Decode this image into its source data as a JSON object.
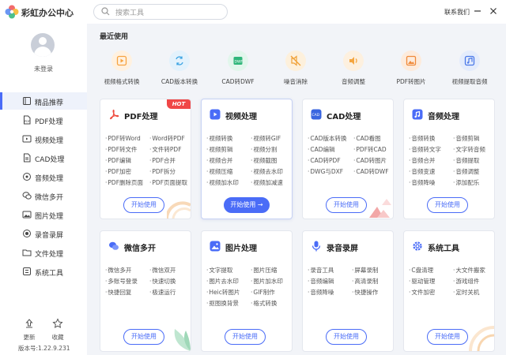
{
  "app": {
    "title": "彩虹办公中心",
    "contact": "联系我们"
  },
  "search": {
    "placeholder": "搜索工具"
  },
  "user": {
    "login_label": "未登录"
  },
  "nav": [
    {
      "label": "精品推荐",
      "icon": "recommend-icon",
      "active": true
    },
    {
      "label": "PDF处理",
      "icon": "pdf-icon"
    },
    {
      "label": "视频处理",
      "icon": "video-icon"
    },
    {
      "label": "CAD处理",
      "icon": "cad-icon"
    },
    {
      "label": "音频处理",
      "icon": "audio-icon"
    },
    {
      "label": "微信多开",
      "icon": "wechat-icon"
    },
    {
      "label": "图片处理",
      "icon": "image-icon"
    },
    {
      "label": "录音录屏",
      "icon": "record-icon"
    },
    {
      "label": "文件处理",
      "icon": "folder-icon"
    },
    {
      "label": "系统工具",
      "icon": "system-icon"
    }
  ],
  "bottom": {
    "update": "更新",
    "favorite": "收藏",
    "version": "版本号:1.22.9.231"
  },
  "recent": {
    "title": "最近使用",
    "items": [
      {
        "label": "视频格式转换",
        "color": "#f7a341",
        "bg": "#fff1e0"
      },
      {
        "label": "CAD版本转换",
        "color": "#3aa3e3",
        "bg": "#e3f2fc"
      },
      {
        "label": "CAD转DWF",
        "color": "#2fb67a",
        "bg": "#e2f6ec"
      },
      {
        "label": "噪音消除",
        "color": "#f0a035",
        "bg": "#fdf0dc"
      },
      {
        "label": "音频调整",
        "color": "#f4a640",
        "bg": "#fdf0df"
      },
      {
        "label": "PDF转图片",
        "color": "#f08a3a",
        "bg": "#fdebdc"
      },
      {
        "label": "视频提取音频",
        "color": "#4a78e8",
        "bg": "#e4ecfc"
      }
    ]
  },
  "cards": [
    {
      "title": "PDF处理",
      "badge": "HOT",
      "color": "#ee4b3e",
      "features": [
        "PDF转Word",
        "Word转PDF",
        "PDF转文件",
        "文件转PDF",
        "PDF编辑",
        "PDF合并",
        "PDF加密",
        "PDF拆分",
        "PDF删除页面",
        "PDF页面提取"
      ],
      "button": "开始使用"
    },
    {
      "title": "视频处理",
      "color": "#4a6cf7",
      "features": [
        "视频转换",
        "视频转GIF",
        "视频剪辑",
        "视频分割",
        "视频合并",
        "视频截图",
        "视频压缩",
        "视频去水印",
        "视频加水印",
        "视频加减速"
      ],
      "button": "开始使用 →"
    },
    {
      "title": "CAD处理",
      "color": "#3a66e0",
      "features": [
        "CAD版本转换",
        "CAD看图",
        "CAD编辑",
        "PDF转CAD",
        "CAD转PDF",
        "CAD转图片",
        "DWG与DXF",
        "CAD转DWF"
      ],
      "button": "开始使用"
    },
    {
      "title": "音频处理",
      "color": "#4a6cf7",
      "features": [
        "音频转换",
        "音频剪辑",
        "音频转文字",
        "文字转音频",
        "音频合并",
        "音频提取",
        "音频变速",
        "音频调整",
        "音频降噪",
        "添加配乐"
      ],
      "button": "开始使用"
    },
    {
      "title": "微信多开",
      "color": "#4a6cf7",
      "features": [
        "微信多开",
        "微信双开",
        "多账号登录",
        "快速切换",
        "快捷回复",
        "极速运行"
      ],
      "button": "开始使用"
    },
    {
      "title": "图片处理",
      "color": "#4a6cf7",
      "features": [
        "文字提取",
        "图片压缩",
        "图片去水印",
        "图片加水印",
        "Heic转图片",
        "GIF制作",
        "抠图换背景",
        "格式转换"
      ],
      "button": "开始使用"
    },
    {
      "title": "录音录屏",
      "color": "#4a6cf7",
      "features": [
        "录音工具",
        "屏幕录制",
        "音频编辑",
        "高清录制",
        "音频降噪",
        "快捷操作"
      ],
      "button": "开始使用"
    },
    {
      "title": "系统工具",
      "color": "#4a6cf7",
      "features": [
        "C盘清理",
        "大文件搬家",
        "驱动管理",
        "游戏组件",
        "文件加密",
        "定时关机"
      ],
      "button": "开始使用"
    }
  ]
}
